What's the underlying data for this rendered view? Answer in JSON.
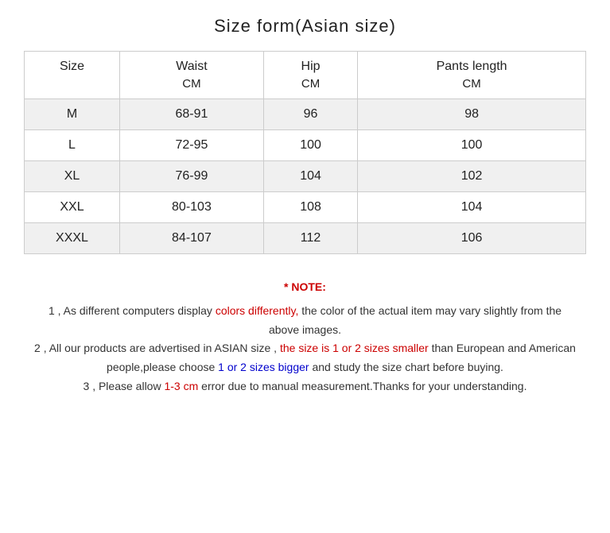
{
  "title": "Size form(Asian size)",
  "table": {
    "headers": [
      "Size",
      "Waist",
      "Hip",
      "Pants length"
    ],
    "unit": "CM",
    "rows": [
      {
        "size": "M",
        "waist": "68-91",
        "hip": "96",
        "pants": "98"
      },
      {
        "size": "L",
        "waist": "72-95",
        "hip": "100",
        "pants": "100"
      },
      {
        "size": "XL",
        "waist": "76-99",
        "hip": "104",
        "pants": "102"
      },
      {
        "size": "XXL",
        "waist": "80-103",
        "hip": "108",
        "pants": "104"
      },
      {
        "size": "XXXL",
        "waist": "84-107",
        "hip": "112",
        "pants": "106"
      }
    ]
  },
  "notes": {
    "title": "* NOTE:",
    "note1_start": "1 , As different computers display ",
    "note1_red": "colors differently,",
    "note1_end": " the color of the actual item may vary slightly from the above images.",
    "note2_start": "2 , All our products are advertised in ASIAN size , ",
    "note2_red": "the size is 1 or 2 sizes smaller",
    "note2_mid": " than European and American people,please choose ",
    "note2_blue": "1 or 2 sizes bigger",
    "note2_end": " and study the size chart before buying.",
    "note3_start": "3 , Please allow ",
    "note3_red": "1-3 cm",
    "note3_end": " error due to manual measurement.Thanks for your understanding."
  }
}
